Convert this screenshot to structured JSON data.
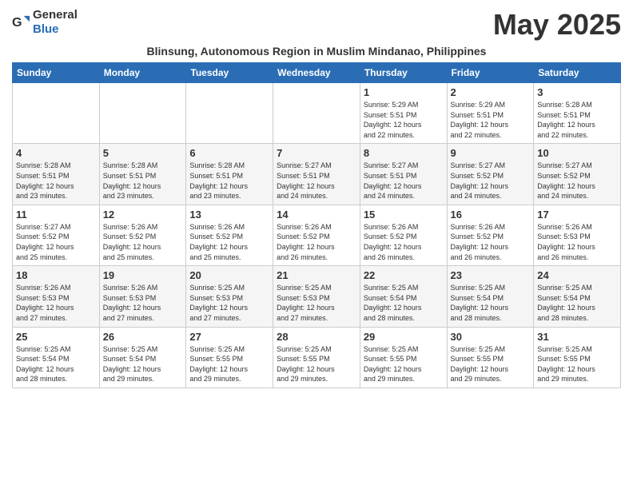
{
  "header": {
    "logo_general": "General",
    "logo_blue": "Blue",
    "month_year": "May 2025",
    "subtitle": "Blinsung, Autonomous Region in Muslim Mindanao, Philippines"
  },
  "days_of_week": [
    "Sunday",
    "Monday",
    "Tuesday",
    "Wednesday",
    "Thursday",
    "Friday",
    "Saturday"
  ],
  "weeks": [
    [
      {
        "day": "",
        "info": ""
      },
      {
        "day": "",
        "info": ""
      },
      {
        "day": "",
        "info": ""
      },
      {
        "day": "",
        "info": ""
      },
      {
        "day": "1",
        "info": "Sunrise: 5:29 AM\nSunset: 5:51 PM\nDaylight: 12 hours\nand 22 minutes."
      },
      {
        "day": "2",
        "info": "Sunrise: 5:29 AM\nSunset: 5:51 PM\nDaylight: 12 hours\nand 22 minutes."
      },
      {
        "day": "3",
        "info": "Sunrise: 5:28 AM\nSunset: 5:51 PM\nDaylight: 12 hours\nand 22 minutes."
      }
    ],
    [
      {
        "day": "4",
        "info": "Sunrise: 5:28 AM\nSunset: 5:51 PM\nDaylight: 12 hours\nand 23 minutes."
      },
      {
        "day": "5",
        "info": "Sunrise: 5:28 AM\nSunset: 5:51 PM\nDaylight: 12 hours\nand 23 minutes."
      },
      {
        "day": "6",
        "info": "Sunrise: 5:28 AM\nSunset: 5:51 PM\nDaylight: 12 hours\nand 23 minutes."
      },
      {
        "day": "7",
        "info": "Sunrise: 5:27 AM\nSunset: 5:51 PM\nDaylight: 12 hours\nand 24 minutes."
      },
      {
        "day": "8",
        "info": "Sunrise: 5:27 AM\nSunset: 5:51 PM\nDaylight: 12 hours\nand 24 minutes."
      },
      {
        "day": "9",
        "info": "Sunrise: 5:27 AM\nSunset: 5:52 PM\nDaylight: 12 hours\nand 24 minutes."
      },
      {
        "day": "10",
        "info": "Sunrise: 5:27 AM\nSunset: 5:52 PM\nDaylight: 12 hours\nand 24 minutes."
      }
    ],
    [
      {
        "day": "11",
        "info": "Sunrise: 5:27 AM\nSunset: 5:52 PM\nDaylight: 12 hours\nand 25 minutes."
      },
      {
        "day": "12",
        "info": "Sunrise: 5:26 AM\nSunset: 5:52 PM\nDaylight: 12 hours\nand 25 minutes."
      },
      {
        "day": "13",
        "info": "Sunrise: 5:26 AM\nSunset: 5:52 PM\nDaylight: 12 hours\nand 25 minutes."
      },
      {
        "day": "14",
        "info": "Sunrise: 5:26 AM\nSunset: 5:52 PM\nDaylight: 12 hours\nand 26 minutes."
      },
      {
        "day": "15",
        "info": "Sunrise: 5:26 AM\nSunset: 5:52 PM\nDaylight: 12 hours\nand 26 minutes."
      },
      {
        "day": "16",
        "info": "Sunrise: 5:26 AM\nSunset: 5:52 PM\nDaylight: 12 hours\nand 26 minutes."
      },
      {
        "day": "17",
        "info": "Sunrise: 5:26 AM\nSunset: 5:53 PM\nDaylight: 12 hours\nand 26 minutes."
      }
    ],
    [
      {
        "day": "18",
        "info": "Sunrise: 5:26 AM\nSunset: 5:53 PM\nDaylight: 12 hours\nand 27 minutes."
      },
      {
        "day": "19",
        "info": "Sunrise: 5:26 AM\nSunset: 5:53 PM\nDaylight: 12 hours\nand 27 minutes."
      },
      {
        "day": "20",
        "info": "Sunrise: 5:25 AM\nSunset: 5:53 PM\nDaylight: 12 hours\nand 27 minutes."
      },
      {
        "day": "21",
        "info": "Sunrise: 5:25 AM\nSunset: 5:53 PM\nDaylight: 12 hours\nand 27 minutes."
      },
      {
        "day": "22",
        "info": "Sunrise: 5:25 AM\nSunset: 5:54 PM\nDaylight: 12 hours\nand 28 minutes."
      },
      {
        "day": "23",
        "info": "Sunrise: 5:25 AM\nSunset: 5:54 PM\nDaylight: 12 hours\nand 28 minutes."
      },
      {
        "day": "24",
        "info": "Sunrise: 5:25 AM\nSunset: 5:54 PM\nDaylight: 12 hours\nand 28 minutes."
      }
    ],
    [
      {
        "day": "25",
        "info": "Sunrise: 5:25 AM\nSunset: 5:54 PM\nDaylight: 12 hours\nand 28 minutes."
      },
      {
        "day": "26",
        "info": "Sunrise: 5:25 AM\nSunset: 5:54 PM\nDaylight: 12 hours\nand 29 minutes."
      },
      {
        "day": "27",
        "info": "Sunrise: 5:25 AM\nSunset: 5:55 PM\nDaylight: 12 hours\nand 29 minutes."
      },
      {
        "day": "28",
        "info": "Sunrise: 5:25 AM\nSunset: 5:55 PM\nDaylight: 12 hours\nand 29 minutes."
      },
      {
        "day": "29",
        "info": "Sunrise: 5:25 AM\nSunset: 5:55 PM\nDaylight: 12 hours\nand 29 minutes."
      },
      {
        "day": "30",
        "info": "Sunrise: 5:25 AM\nSunset: 5:55 PM\nDaylight: 12 hours\nand 29 minutes."
      },
      {
        "day": "31",
        "info": "Sunrise: 5:25 AM\nSunset: 5:55 PM\nDaylight: 12 hours\nand 29 minutes."
      }
    ]
  ]
}
